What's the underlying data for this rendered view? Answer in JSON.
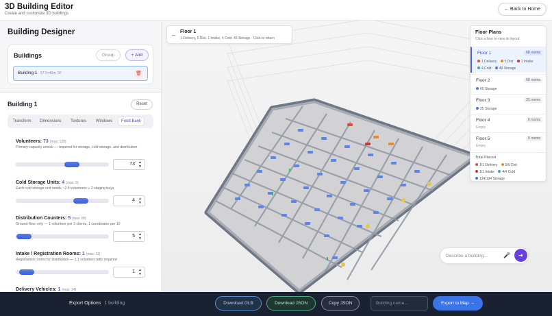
{
  "header": {
    "title": "3D Building Editor",
    "subtitle": "Create and customize 3D buildings",
    "back_label": "← Back to Home"
  },
  "left": {
    "title": "Building Designer",
    "buildings_label": "Buildings",
    "group_label": "Group",
    "add_label": "+ Add",
    "building_item": {
      "name": "Building 1",
      "dims": "57.5×46m, 5F"
    },
    "panel_title": "Building 1",
    "reset_label": "Reset",
    "tabs": [
      "Transform",
      "Dimensions",
      "Textures",
      "Windows",
      "Food Bank"
    ],
    "active_tab": "Food Bank",
    "sliders": [
      {
        "label": "Volunteers:",
        "value": "73",
        "max": "(max: 128)",
        "desc": "Primary capacity unlock — required for storage, cold storage, and distribution",
        "fraction": 0.57
      },
      {
        "label": "Cold Storage Units:",
        "value": "4",
        "max": "(max: 6)",
        "desc": "Each cold storage unit needs ~2.5 volunteers + 2 staging bays",
        "fraction": 0.67
      },
      {
        "label": "Distribution Counters:",
        "value": "5",
        "max": "(max: 88)",
        "desc": "Ground-floor only — 1 volunteer per 3 clients, 1 coordinator per 10",
        "fraction": 0.06
      },
      {
        "label": "Intake / Registration Rooms:",
        "value": "1",
        "max": "(max: 11)",
        "desc": "Registration rooms for distribution — 1:1 volunteer ratio required",
        "fraction": 0.09
      },
      {
        "label": "Delivery Vehicles:",
        "value": "1",
        "max": "(max: 24)",
        "desc": "",
        "fraction": 0.04
      }
    ]
  },
  "floor_chip": {
    "title": "Floor 1",
    "subtitle": "1 Delivery, 5 Dist, 1 Intake, 4 Cold, 49 Storage · Click to return"
  },
  "floor_plans": {
    "title": "Floor Plans",
    "subtitle": "Click a floor to view its layout",
    "floors": [
      {
        "name": "Floor 1",
        "badge": "60 rooms",
        "active": true,
        "tags": [
          {
            "label": "1 Delivery",
            "color": "#e0503c"
          },
          {
            "label": "5 Dist",
            "color": "#e88a2c"
          },
          {
            "label": "1 Intake",
            "color": "#c93b3b"
          },
          {
            "label": "4 Cold",
            "color": "#3aa6b8"
          },
          {
            "label": "49 Storage",
            "color": "#4a78d8"
          }
        ]
      },
      {
        "name": "Floor 2",
        "badge": "60 rooms",
        "active": false,
        "tags": [
          {
            "label": "60 Storage",
            "color": "#4a78d8"
          }
        ]
      },
      {
        "name": "Floor 3",
        "badge": "25 rooms",
        "active": false,
        "tags": [
          {
            "label": "25 Storage",
            "color": "#4a78d8"
          }
        ]
      },
      {
        "name": "Floor 4",
        "badge": "0 rooms",
        "active": false,
        "empty": "Empty"
      },
      {
        "name": "Floor 5",
        "badge": "0 rooms",
        "active": false,
        "empty": "Empty"
      }
    ],
    "total_title": "Total Placed",
    "totals": [
      {
        "label": "1/1 Delivery",
        "color": "#e0503c"
      },
      {
        "label": "5/5 Dist",
        "color": "#e88a2c"
      },
      {
        "label": "1/1 Intake",
        "color": "#c93b3b"
      },
      {
        "label": "4/4 Cold",
        "color": "#3aa6b8"
      },
      {
        "label": "134/134 Storage",
        "color": "#4a78d8"
      }
    ]
  },
  "describe": {
    "placeholder": "Describe a building..."
  },
  "bottom": {
    "export_label": "Export Options",
    "export_count": "1 building",
    "glb_label": "Download GLB",
    "json_label": "Download JSON",
    "copy_label": "Copy JSON",
    "name_placeholder": "Building name...",
    "map_label": "Export to Map →"
  },
  "colors": {
    "accent": "#4b62d9",
    "purple": "#6a3fe0",
    "map_button": "#3a74e6",
    "bottom_bar": "#1a2130"
  }
}
